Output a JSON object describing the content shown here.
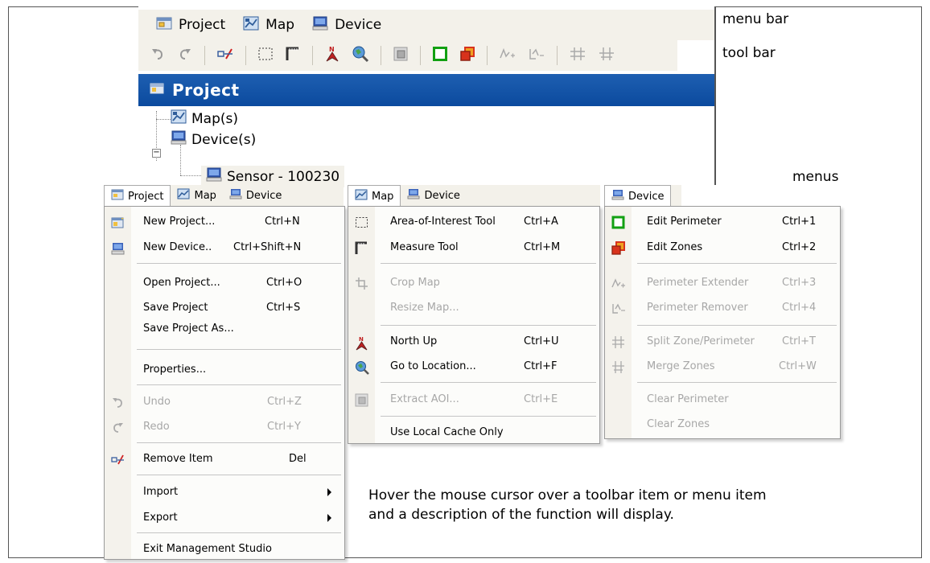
{
  "callouts": {
    "menu_bar": "menu bar",
    "tool_bar": "tool bar",
    "menus": "menus"
  },
  "app": {
    "menubar": [
      {
        "label": "Project",
        "icon": "project-icon"
      },
      {
        "label": "Map",
        "icon": "map-icon"
      },
      {
        "label": "Device",
        "icon": "device-icon"
      }
    ],
    "toolbar": [
      "undo-icon",
      "redo-icon",
      "remove-item-icon",
      "area-of-interest-icon",
      "measure-tool-icon",
      "north-up-icon",
      "go-to-location-icon",
      "extract-aoi-icon",
      "edit-perimeter-icon",
      "edit-zones-icon",
      "perimeter-extender-icon",
      "perimeter-remover-icon",
      "split-zone-icon",
      "merge-zones-icon"
    ],
    "panel_title": "Project",
    "tree": {
      "maps": "Map(s)",
      "devices": "Device(s)",
      "sensor": "Sensor - 100230"
    }
  },
  "project_menu": {
    "tabs": [
      "Project",
      "Map",
      "Device"
    ],
    "items": [
      {
        "label": "New Project...",
        "shortcut": "Ctrl+N",
        "icon": "new-project-icon",
        "disabled": false
      },
      {
        "label": "New Device..",
        "shortcut": "Ctrl+Shift+N",
        "icon": "new-device-icon",
        "disabled": false
      },
      {
        "label": "Open Project...",
        "shortcut": "Ctrl+O",
        "disabled": false
      },
      {
        "label": "Save Project",
        "shortcut": "Ctrl+S",
        "disabled": false
      },
      {
        "label": "Save Project As...",
        "shortcut": "",
        "disabled": false
      },
      {
        "label": "Properties...",
        "shortcut": "",
        "disabled": false
      },
      {
        "label": "Undo",
        "shortcut": "Ctrl+Z",
        "icon": "undo-icon",
        "disabled": true
      },
      {
        "label": "Redo",
        "shortcut": "Ctrl+Y",
        "icon": "redo-icon",
        "disabled": true
      },
      {
        "label": "Remove Item",
        "shortcut": "Del",
        "icon": "remove-item-icon",
        "disabled": false
      },
      {
        "label": "Import",
        "shortcut": "",
        "submenu": true,
        "disabled": false
      },
      {
        "label": "Export",
        "shortcut": "",
        "submenu": true,
        "disabled": false
      },
      {
        "label": "Exit Management Studio",
        "shortcut": "",
        "disabled": false
      }
    ]
  },
  "map_menu": {
    "tabs": [
      "Map",
      "Device"
    ],
    "items": [
      {
        "label": "Area-of-Interest Tool",
        "shortcut": "Ctrl+A",
        "icon": "area-of-interest-icon",
        "disabled": false
      },
      {
        "label": "Measure Tool",
        "shortcut": "Ctrl+M",
        "icon": "measure-tool-icon",
        "disabled": false
      },
      {
        "label": "Crop Map",
        "shortcut": "",
        "icon": "crop-map-icon",
        "disabled": true
      },
      {
        "label": "Resize Map...",
        "shortcut": "",
        "disabled": true
      },
      {
        "label": "North Up",
        "shortcut": "Ctrl+U",
        "icon": "north-up-icon",
        "disabled": false
      },
      {
        "label": "Go to Location...",
        "shortcut": "Ctrl+F",
        "icon": "go-to-location-icon",
        "disabled": false
      },
      {
        "label": "Extract AOI...",
        "shortcut": "Ctrl+E",
        "icon": "extract-aoi-icon",
        "disabled": true
      },
      {
        "label": "Use Local Cache Only",
        "shortcut": "",
        "disabled": false
      }
    ]
  },
  "device_menu": {
    "tabs": [
      "Device"
    ],
    "items": [
      {
        "label": "Edit Perimeter",
        "shortcut": "Ctrl+1",
        "icon": "edit-perimeter-icon",
        "disabled": false
      },
      {
        "label": "Edit Zones",
        "shortcut": "Ctrl+2",
        "icon": "edit-zones-icon",
        "disabled": false
      },
      {
        "label": "Perimeter Extender",
        "shortcut": "Ctrl+3",
        "icon": "perimeter-extender-icon",
        "disabled": true
      },
      {
        "label": "Perimeter Remover",
        "shortcut": "Ctrl+4",
        "icon": "perimeter-remover-icon",
        "disabled": true
      },
      {
        "label": "Split Zone/Perimeter",
        "shortcut": "Ctrl+T",
        "icon": "split-zone-icon",
        "disabled": true
      },
      {
        "label": "Merge Zones",
        "shortcut": "Ctrl+W",
        "icon": "merge-zones-icon",
        "disabled": true
      },
      {
        "label": "Clear Perimeter",
        "shortcut": "",
        "disabled": true
      },
      {
        "label": "Clear Zones",
        "shortcut": "",
        "disabled": true
      }
    ]
  },
  "hint": {
    "line1": "Hover the mouse cursor over a toolbar item or menu item",
    "line2": "and a description of the function will display."
  },
  "colors": {
    "header_blue": "#0b4a9e",
    "menu_bg": "#f3f1ea",
    "disabled_text": "#a7a7a7",
    "perimeter_green": "#12a012",
    "zone_red": "#d8321c"
  }
}
